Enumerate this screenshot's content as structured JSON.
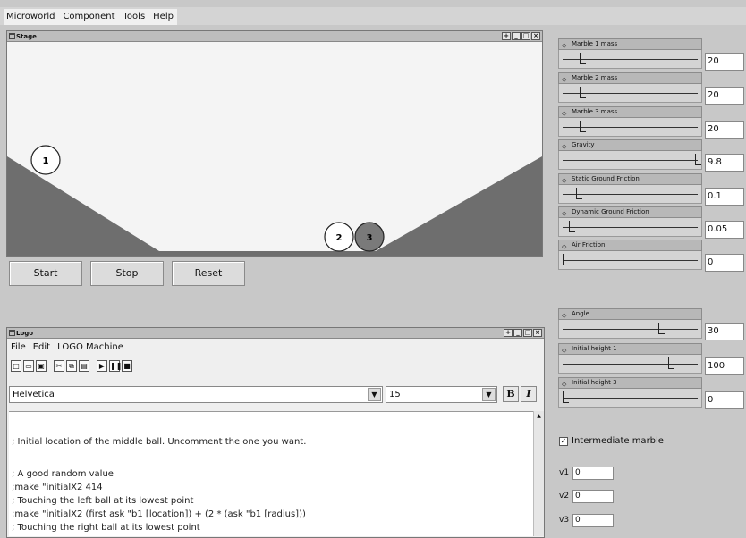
{
  "menubar": {
    "items": [
      "Microworld",
      "Component",
      "Tools",
      "Help"
    ]
  },
  "stage": {
    "title": "Stage",
    "window_buttons": [
      "+",
      "_",
      "□",
      "×"
    ],
    "marbles": [
      "1",
      "2",
      "3"
    ],
    "buttons": {
      "start": "Start",
      "stop": "Stop",
      "reset": "Reset"
    }
  },
  "sliders": [
    {
      "title": "Marble 1 mass",
      "value": "20",
      "level": 0.13
    },
    {
      "title": "Marble 2 mass",
      "value": "20",
      "level": 0.13
    },
    {
      "title": "Marble 3 mass",
      "value": "20",
      "level": 0.13
    },
    {
      "title": "Gravity",
      "value": "9.8",
      "level": 1.0
    },
    {
      "title": "Static Ground Friction",
      "value": "0.1",
      "level": 0.1
    },
    {
      "title": "Dynamic Ground Friction",
      "value": "0.05",
      "level": 0.05
    },
    {
      "title": "Air Friction",
      "value": "0",
      "level": 0.0
    },
    {
      "title": "Angle",
      "value": "30",
      "level": 0.72
    },
    {
      "title": "Initial height 1",
      "value": "100",
      "level": 0.8
    },
    {
      "title": "Initial height 3",
      "value": "0",
      "level": 0.0
    }
  ],
  "options": {
    "intermediate_marble": {
      "label": "Intermediate marble",
      "checked": true
    },
    "velocities": [
      {
        "label": "v1",
        "value": "0"
      },
      {
        "label": "v2",
        "value": "0"
      },
      {
        "label": "v3",
        "value": "0"
      }
    ]
  },
  "logo": {
    "title": "Logo",
    "menu": [
      "File",
      "Edit",
      "LOGO Machine"
    ],
    "toolbar_icons": [
      "new-file-icon",
      "open-file-icon",
      "save-icon",
      "cut-icon",
      "copy-icon",
      "paste-icon",
      "run-icon",
      "pause-icon",
      "stop-icon"
    ],
    "font_name": "Helvetica",
    "font_size": "15",
    "bold_label": "B",
    "italic_label": "I",
    "code_lines": [
      "; Initial location of the middle ball. Uncomment the one you want.",
      "",
      "; A good random value",
      ";make \"initialX2 414",
      "; Touching the left ball at its lowest point",
      ";make \"initialX2 (first ask \"b1 [location]) + (2 * (ask \"b1 [radius]))",
      "; Touching the right ball at its lowest point"
    ]
  },
  "colors": {
    "ground": "#6e6e6e",
    "stage_bg": "#f4f4f4",
    "marble3": "#7a7a7a"
  }
}
